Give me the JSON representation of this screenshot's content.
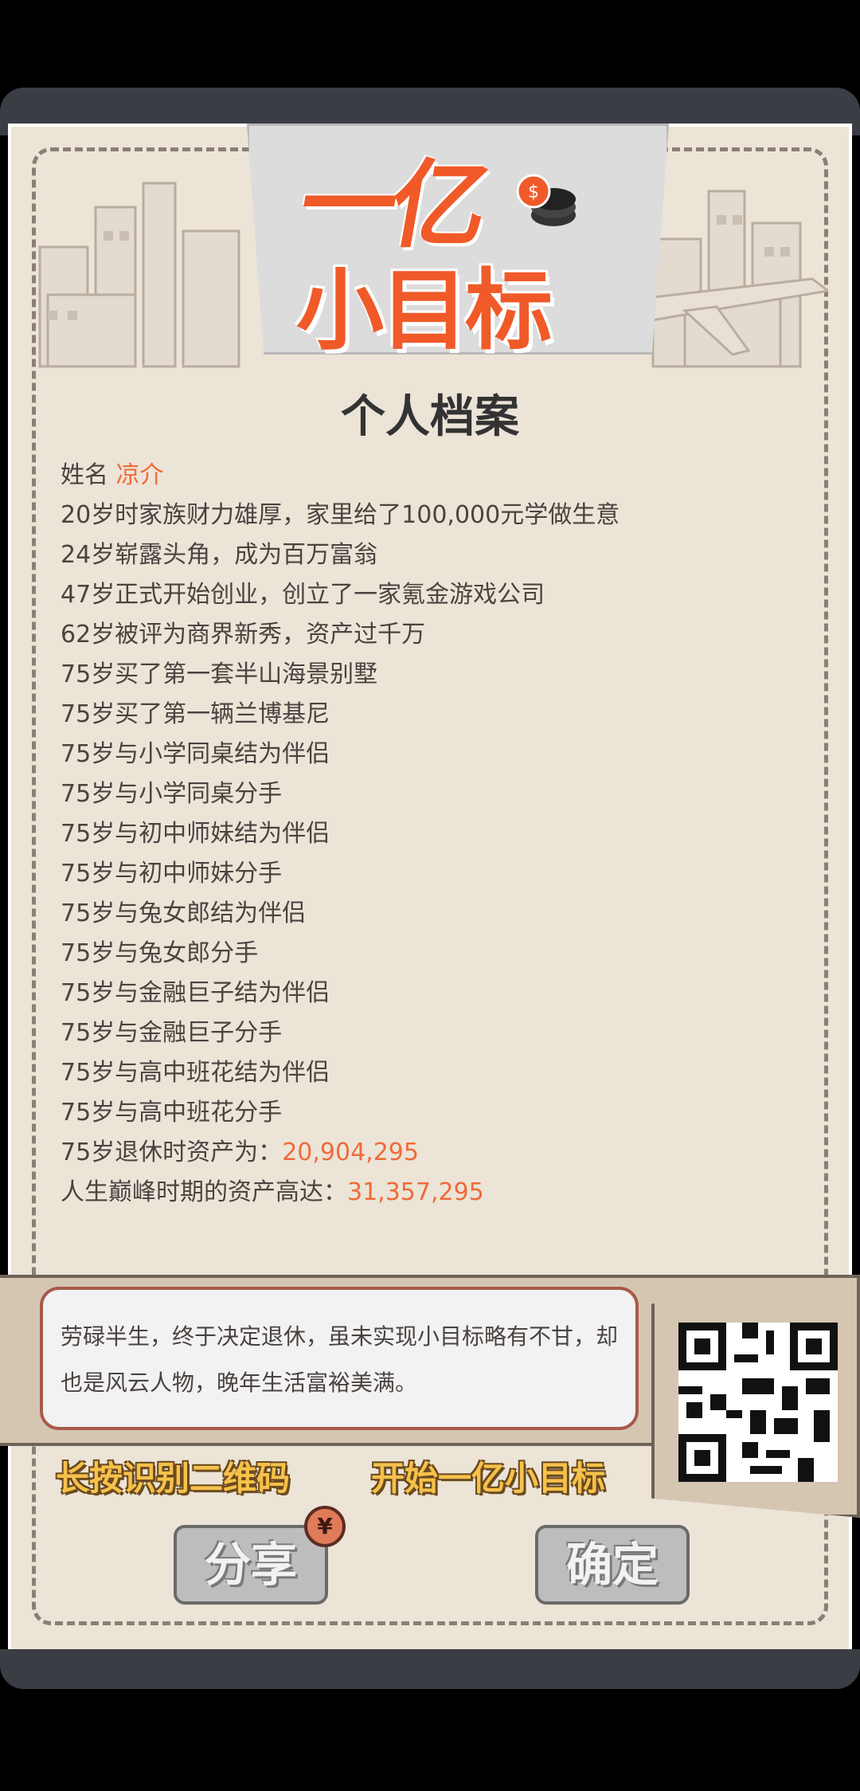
{
  "header": {
    "logo_line1": "一亿",
    "logo_line2": "小目标"
  },
  "title": "个人档案",
  "profile": {
    "name_label": "姓名",
    "name_value": "凉介",
    "events": [
      "20岁时家族财力雄厚，家里给了100,000元学做生意",
      "24岁崭露头角，成为百万富翁",
      "47岁正式开始创业，创立了一家氪金游戏公司",
      "62岁被评为商界新秀，资产过千万",
      "75岁买了第一套半山海景别墅",
      "75岁买了第一辆兰博基尼",
      "75岁与小学同桌结为伴侣",
      "75岁与小学同桌分手",
      "75岁与初中师妹结为伴侣",
      "75岁与初中师妹分手",
      "75岁与兔女郎结为伴侣",
      "75岁与兔女郎分手",
      "75岁与金融巨子结为伴侣",
      "75岁与金融巨子分手",
      "75岁与高中班花结为伴侣",
      "75岁与高中班花分手"
    ],
    "retire_label": "75岁退休时资产为：",
    "retire_value": "20,904,295",
    "peak_label": "人生巅峰时期的资产高达：",
    "peak_value": "31,357,295"
  },
  "summary": {
    "text": "劳碌半生，终于决定退休，虽未实现小目标略有不甘，却也是风云人物，晚年生活富裕美满。"
  },
  "qr_caption_left": "长按识别二维码",
  "qr_caption_right": "开始一亿小目标",
  "buttons": {
    "share": "分享",
    "confirm": "确定",
    "coin_symbol": "¥"
  },
  "colors": {
    "accent": "#ef6b3a",
    "paper": "#ece4d7"
  }
}
